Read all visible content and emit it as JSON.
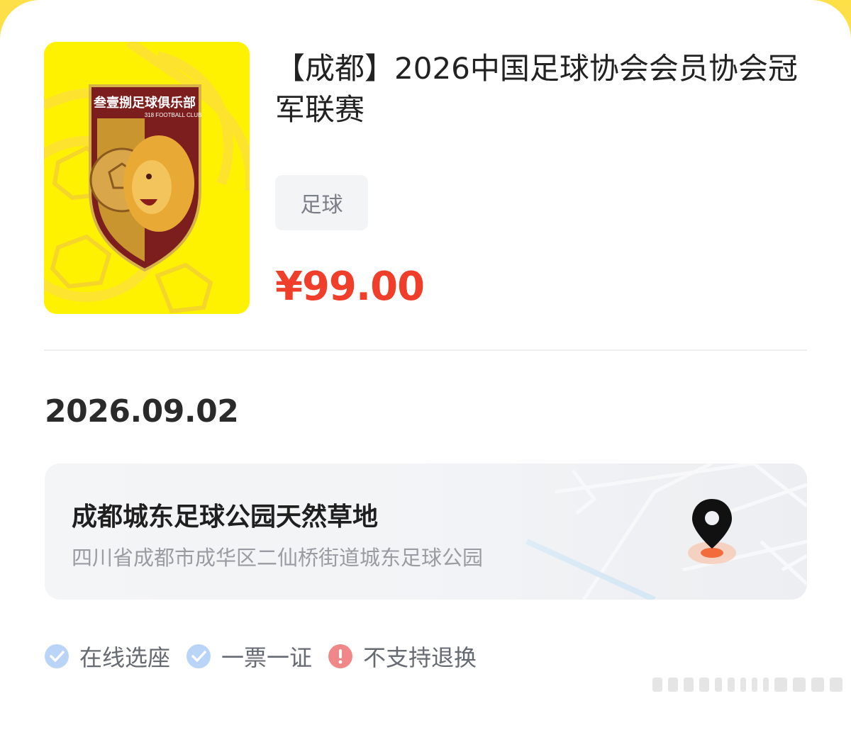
{
  "event": {
    "title": "【成都】2026中国足球协会会员协会冠军联赛",
    "category_tag": "足球",
    "price": "¥99.00",
    "date": "2026.09.02"
  },
  "poster": {
    "club_name_cn": "叁壹捌足球俱乐部",
    "club_name_en": "318 FOOTBALL CLUB",
    "icon": "lion-shield-logo"
  },
  "venue": {
    "name": "成都城东足球公园天然草地",
    "address": "四川省成都市成华区二仙桥街道城东足球公园",
    "icon": "location-pin-icon"
  },
  "features": [
    {
      "label": "在线选座",
      "icon": "check-circle-icon",
      "color": "#b9d4f7"
    },
    {
      "label": "一票一证",
      "icon": "check-circle-icon",
      "color": "#b9d4f7"
    },
    {
      "label": "不支持退换",
      "icon": "exclamation-circle-icon",
      "color": "#f0888a"
    }
  ],
  "colors": {
    "price": "#ef3f2a",
    "poster_bg": "#fff200",
    "shield_dark": "#7d1e1e",
    "shield_gold": "#c8952f",
    "pin_accent": "#f26b3a"
  }
}
